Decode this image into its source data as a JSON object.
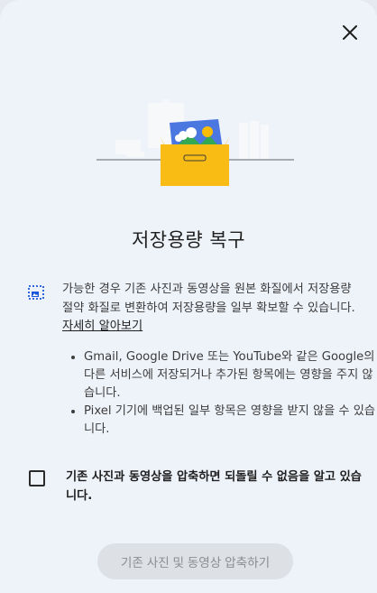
{
  "dialog": {
    "close_icon": "close-icon",
    "title": "저장용량 복구",
    "info": {
      "icon": "photo-compress-icon",
      "text": "가능한 경우 기존 사진과 동영상을 원본 화질에서 저장용량 절약 화질로 변환하여 저장용량을 일부 확보할 수 있습니다. ",
      "link": "자세히 알아보기"
    },
    "bullets": [
      "Gmail, Google Drive 또는 YouTube와 같은 Google의 다른 서비스에 저장되거나 추가된 항목에는 영향을 주지 않습니다.",
      "Pixel 기기에 백업된 일부 항목은 영향을 받지 않을 수 있습니다."
    ],
    "acknowledge": {
      "checked": false,
      "label": "기존 사진과 동영상을 압축하면 되돌릴 수 없음을 알고 있습니다."
    },
    "compress_button": "기존 사진 및 동영상 압축하기"
  }
}
